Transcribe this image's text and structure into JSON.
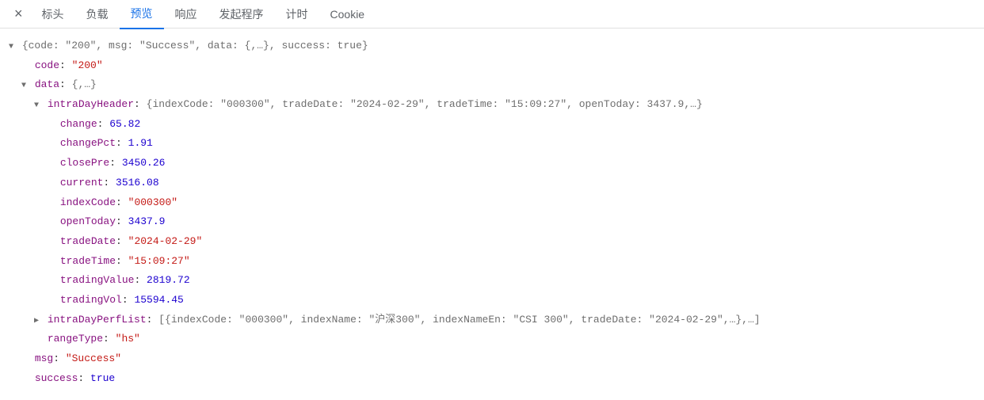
{
  "tabs": {
    "close": "×",
    "items": [
      "标头",
      "负载",
      "预览",
      "响应",
      "发起程序",
      "计时",
      "Cookie"
    ],
    "activeIndex": 2
  },
  "summaryLine": "{code: \"200\", msg: \"Success\", data: {,…}, success: true}",
  "root": {
    "code_key": "code",
    "code_val": "\"200\"",
    "data_key": "data",
    "data_summary": "{,…}",
    "msg_key": "msg",
    "msg_val": "\"Success\"",
    "success_key": "success",
    "success_val": "true"
  },
  "intraDayHeader": {
    "key": "intraDayHeader",
    "summary": "{indexCode: \"000300\", tradeDate: \"2024-02-29\", tradeTime: \"15:09:27\", openToday: 3437.9,…}",
    "fields": {
      "change_key": "change",
      "change_val": "65.82",
      "changePct_key": "changePct",
      "changePct_val": "1.91",
      "closePre_key": "closePre",
      "closePre_val": "3450.26",
      "current_key": "current",
      "current_val": "3516.08",
      "indexCode_key": "indexCode",
      "indexCode_val": "\"000300\"",
      "openToday_key": "openToday",
      "openToday_val": "3437.9",
      "tradeDate_key": "tradeDate",
      "tradeDate_val": "\"2024-02-29\"",
      "tradeTime_key": "tradeTime",
      "tradeTime_val": "\"15:09:27\"",
      "tradingValue_key": "tradingValue",
      "tradingValue_val": "2819.72",
      "tradingVol_key": "tradingVol",
      "tradingVol_val": "15594.45"
    }
  },
  "intraDayPerfList": {
    "key": "intraDayPerfList",
    "summary": "[{indexCode: \"000300\", indexName: \"沪深300\", indexNameEn: \"CSI 300\", tradeDate: \"2024-02-29\",…},…]"
  },
  "rangeType": {
    "key": "rangeType",
    "val": "\"hs\""
  }
}
